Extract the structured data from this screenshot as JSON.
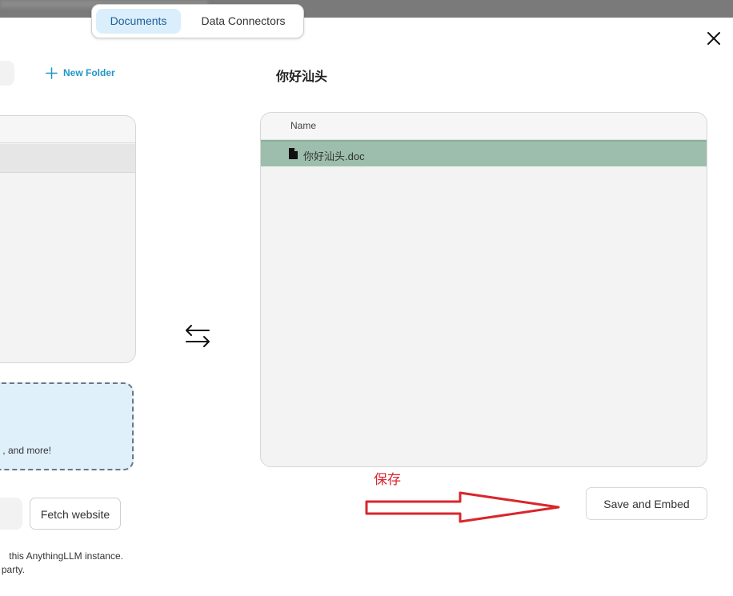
{
  "tabs": [
    {
      "label": "Documents",
      "active": true
    },
    {
      "label": "Data Connectors",
      "active": false
    }
  ],
  "toolbar": {
    "new_folder_label": "New Folder"
  },
  "upload": {
    "drop_hint_fragment": ", and more!",
    "fetch_button_label": "Fetch website",
    "footer_line1": " this AnythingLLM instance.",
    "footer_line2": "party."
  },
  "workspace": {
    "title": "你好汕头",
    "column_name": "Name",
    "files": [
      {
        "name": "你好汕头.doc",
        "selected": true
      }
    ]
  },
  "annotation": {
    "label": "保存",
    "color": "#d9262d"
  },
  "actions": {
    "save_embed_label": "Save and Embed"
  },
  "icons": [
    "close-icon",
    "plus-icon",
    "swap-arrows-icon",
    "file-icon",
    "red-arrow-annotation"
  ],
  "colors": {
    "accent": "#2196c8",
    "active_tab_bg": "#dbeefb",
    "selected_row": "#9dbeac",
    "drop_zone_bg": "#dff0fb"
  }
}
